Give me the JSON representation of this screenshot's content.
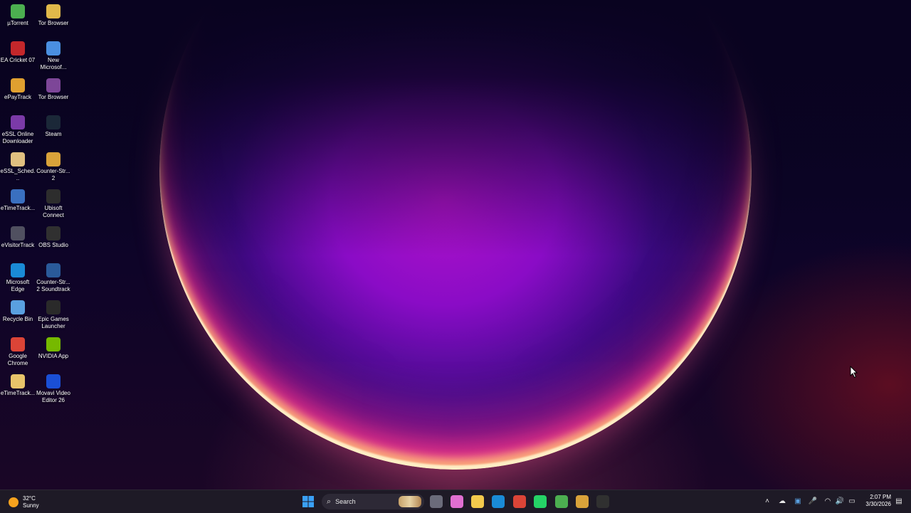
{
  "desktop": {
    "icons": [
      {
        "label": "µTorrent",
        "icon": "utorrent-icon",
        "color": "#4caf50"
      },
      {
        "label": "Tor Browser",
        "icon": "tor-folder-icon",
        "color": "#e0b84a"
      },
      {
        "label": "EA Cricket 07",
        "icon": "cricket-icon",
        "color": "#c3272b"
      },
      {
        "label": "New Microsof...",
        "icon": "document-icon",
        "color": "#4a8fe0"
      },
      {
        "label": "ePayTrack",
        "icon": "epaytrack-icon",
        "color": "#e0a030"
      },
      {
        "label": "Tor Browser",
        "icon": "tor-browser-icon",
        "color": "#7d4698"
      },
      {
        "label": "eSSL Online Downloader",
        "icon": "essl-icon",
        "color": "#7b3aa8"
      },
      {
        "label": "Steam",
        "icon": "steam-icon",
        "color": "#1b2838"
      },
      {
        "label": "eSSL_Sched...",
        "icon": "scheduler-icon",
        "color": "#e0c080"
      },
      {
        "label": "Counter-Str... 2",
        "icon": "cs2-icon",
        "color": "#d9a23a"
      },
      {
        "label": "eTimeTrack...",
        "icon": "etimetrack-icon",
        "color": "#3a70c0"
      },
      {
        "label": "Ubisoft Connect",
        "icon": "ubisoft-icon",
        "color": "#2d2d2d"
      },
      {
        "label": "eVisitorTrack",
        "icon": "evisitor-icon",
        "color": "#505060"
      },
      {
        "label": "OBS Studio",
        "icon": "obs-icon",
        "color": "#303030"
      },
      {
        "label": "Microsoft Edge",
        "icon": "edge-icon",
        "color": "#1a8bd6"
      },
      {
        "label": "Counter-Str... 2 Soundtrack",
        "icon": "soundtrack-icon",
        "color": "#2a5a9a"
      },
      {
        "label": "Recycle Bin",
        "icon": "recycle-bin-icon",
        "color": "#5aa0e0"
      },
      {
        "label": "Epic Games Launcher",
        "icon": "epic-games-icon",
        "color": "#2a2a2a"
      },
      {
        "label": "Google Chrome",
        "icon": "chrome-icon",
        "color": "#db4437"
      },
      {
        "label": "NVIDIA App",
        "icon": "nvidia-icon",
        "color": "#76b900"
      },
      {
        "label": "eTimeTrack...",
        "icon": "etimetrack-folder-icon",
        "color": "#e8c46a"
      },
      {
        "label": "Movavi Video Editor 26",
        "icon": "movavi-icon",
        "color": "#1a4fd6"
      }
    ]
  },
  "taskbar": {
    "weather": {
      "temp": "32°C",
      "condition": "Sunny"
    },
    "search_placeholder": "Search",
    "apps": [
      {
        "name": "start-button",
        "icon": "windows-icon",
        "color": "#3a9af0"
      },
      {
        "name": "task-view-button",
        "icon": "task-view-icon",
        "color": "#6b6b7a"
      },
      {
        "name": "copilot-button",
        "icon": "copilot-icon",
        "color": "#e06fd0"
      },
      {
        "name": "file-explorer-button",
        "icon": "folder-icon",
        "color": "#f2c94c"
      },
      {
        "name": "edge-button",
        "icon": "edge-icon",
        "color": "#1a8bd6"
      },
      {
        "name": "chrome-button",
        "icon": "chrome-icon",
        "color": "#db4437"
      },
      {
        "name": "whatsapp-button",
        "icon": "whatsapp-icon",
        "color": "#25d366"
      },
      {
        "name": "utorrent-button",
        "icon": "utorrent-icon",
        "color": "#4caf50"
      },
      {
        "name": "cs2-button",
        "icon": "cs2-icon",
        "color": "#d9a23a"
      },
      {
        "name": "obs-button",
        "icon": "obs-icon",
        "color": "#303030"
      }
    ],
    "tray": {
      "time": "2:07 PM",
      "date": "3/30/2026",
      "icons": [
        "chevron-up-icon",
        "onedrive-icon",
        "security-icon",
        "microphone-icon",
        "wifi-icon",
        "volume-icon",
        "battery-icon",
        "notification-icon"
      ]
    }
  }
}
